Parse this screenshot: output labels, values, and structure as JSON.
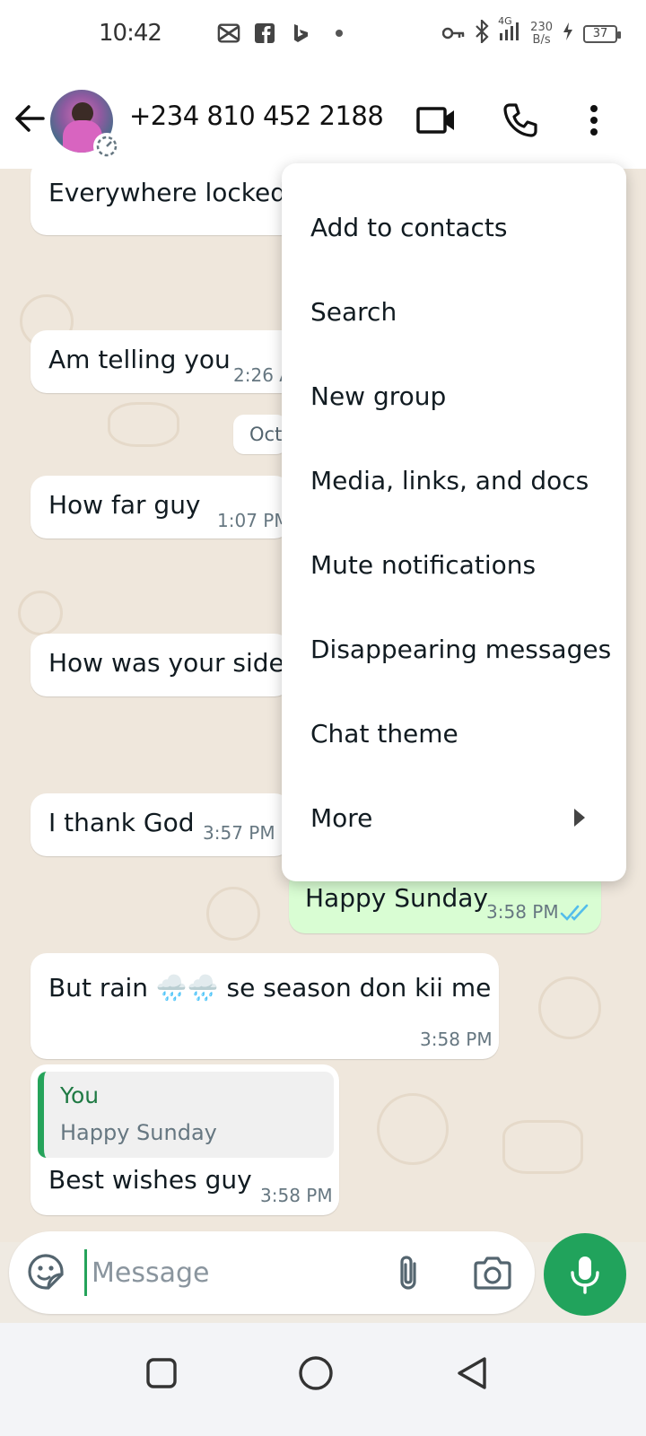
{
  "status_bar": {
    "time": "10:42",
    "speed_value": "230",
    "speed_unit": "B/s",
    "network": "4G",
    "battery": "37"
  },
  "header": {
    "contact": "+234 810 452 2188"
  },
  "messages": [
    {
      "text": "Everywhere locked",
      "time": "",
      "direction": "in"
    },
    {
      "text": "Am telling you",
      "time": "2:26 A",
      "direction": "in"
    },
    {
      "text": "How far guy",
      "time": "1:07 PM",
      "direction": "in"
    },
    {
      "text": "How was your side",
      "time": "",
      "direction": "in"
    },
    {
      "text": "I thank God",
      "time": "3:57 PM",
      "direction": "in"
    },
    {
      "text": "Happy Sunday",
      "time": "3:58 PM",
      "direction": "out"
    },
    {
      "text": "But rain 🌧️🌧️ se season don kii me",
      "time": "3:58 PM",
      "direction": "in"
    },
    {
      "text": "Best wishes guy",
      "time": "3:58 PM",
      "direction": "in",
      "quote_author": "You",
      "quote_text": "Happy Sunday"
    }
  ],
  "date_chip": "Oct",
  "menu": {
    "items": [
      "Add to contacts",
      "Search",
      "New group",
      "Media, links, and docs",
      "Mute notifications",
      "Disappearing messages",
      "Chat theme",
      "More"
    ]
  },
  "composer": {
    "placeholder": "Message"
  },
  "colors": {
    "accent": "#21a35c",
    "outgoing_bubble": "#d9fdd3",
    "read_ticks": "#53bdeb",
    "chat_background": "#efe7dc"
  },
  "icons": {
    "back": "arrow-left-icon",
    "video": "video-camera-icon",
    "call": "phone-icon",
    "menu": "more-vertical-icon",
    "sticker": "sticker-icon",
    "attach": "paperclip-icon",
    "camera": "camera-icon",
    "mic": "microphone-icon"
  }
}
